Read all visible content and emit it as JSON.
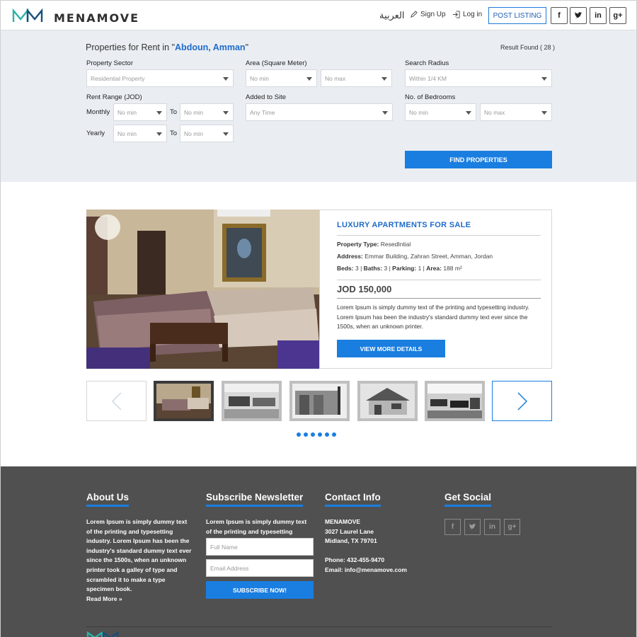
{
  "header": {
    "brand": "MENAMOVE",
    "arabic": "العربية",
    "signup": "Sign Up",
    "login": "Log in",
    "post_listing": "POST LISTING",
    "social": [
      "f",
      "t",
      "in",
      "g+"
    ]
  },
  "search": {
    "title_prefix": "Properties for Rent in \"",
    "location": "Abdoun, Amman",
    "title_suffix": "\"",
    "result": "Result Found ( 28 )",
    "property_sector_label": "Property Sector",
    "property_sector_value": "Residential Property",
    "area_label": "Area (Square Meter)",
    "area_min": "No min",
    "area_max": "No max",
    "radius_label": "Search Radius",
    "radius_value": "Within 1/4 KM",
    "rent_range_label": "Rent Range (JOD)",
    "monthly_label": "Monthly",
    "yearly_label": "Yearly",
    "to_label": "To",
    "rent_monthly_min": "No min",
    "rent_monthly_max": "No min",
    "rent_yearly_min": "No min",
    "rent_yearly_max": "No min",
    "added_label": "Added to Site",
    "added_value": "Any Time",
    "bedrooms_label": "No. of Bedrooms",
    "bed_min": "No min",
    "bed_max": "No max",
    "find_button": "FIND PROPERTIES"
  },
  "listing": {
    "title": "LUXURY APARTMENTS FOR SALE",
    "type_label": "Property Type:",
    "type_value": "ResedIntial",
    "address_label": "Address:",
    "address_value": "Emmar Building, Zahran Street, Amman, Jordan",
    "beds_label": "Beds:",
    "beds_value": "3",
    "baths_label": "Baths:",
    "baths_value": "3",
    "parking_label": "Parking:",
    "parking_value": "1",
    "area_label": "Area:",
    "area_value": "188 m²",
    "price": "JOD 150,000",
    "description": "Lorem Ipsum is simply dummy text of the printing and typesetting industry. Lorem Ipsum has been the industry's standard dummy text ever since the 1500s, when an unknown printer.",
    "details_button": "VIEW MORE DETAILS"
  },
  "footer": {
    "about_title": "About Us",
    "about_text": "Lorem Ipsum is simply dummy text of the printing and typesetting industry. Lorem Ipsum has been the industry's standard dummy text ever since the 1500s, when an unknown printer took a galley of type and scrambled it to make a type specimen book.",
    "read_more": "Read More »",
    "newsletter_title": "Subscribe Newsletter",
    "newsletter_text": "Lorem Ipsum is simply dummy text of the printing and typesetting industry.",
    "full_name_placeholder": "Full Name",
    "email_placeholder": "Email Address",
    "subscribe_button": "SUBSCRIBE NOW!",
    "contact_title": "Contact Info",
    "company": "MENAMOVE",
    "street": "3027 Laurel Lane",
    "city": "Midland, TX 79701",
    "phone": "Phone: 432-455-9470",
    "email": "Email: info@menamove.com",
    "social_title": "Get Social",
    "social": [
      "f",
      "t",
      "in",
      "g+"
    ]
  },
  "colors": {
    "accent": "#1a7ee0",
    "search_bg": "#eaeef3",
    "footer_bg": "#505050",
    "logo_teal": "#2bb3a8"
  }
}
